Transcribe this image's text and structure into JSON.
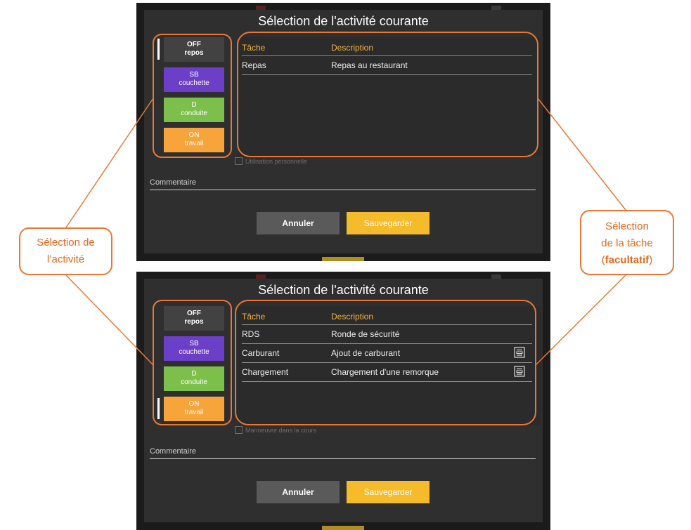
{
  "top_screen": {
    "title": "Sélection de l'activité courante",
    "statuses": [
      {
        "code": "OFF",
        "label": "repos"
      },
      {
        "code": "SB",
        "label": "couchette"
      },
      {
        "code": "D",
        "label": "conduite"
      },
      {
        "code": "ON",
        "label": "travail"
      }
    ],
    "selected_status": "OFF",
    "task_table": {
      "headers": [
        "Tâche",
        "Description"
      ],
      "rows": [
        {
          "task": "Repas",
          "description": "Repas au restaurant"
        }
      ]
    },
    "checkbox_label": "Utilisation personnelle",
    "comment_label": "Commentaire",
    "cancel_label": "Annuler",
    "save_label": "Sauvegarder"
  },
  "bottom_screen": {
    "title": "Sélection de l'activité courante",
    "statuses": [
      {
        "code": "OFF",
        "label": "repos"
      },
      {
        "code": "SB",
        "label": "couchette"
      },
      {
        "code": "D",
        "label": "conduite"
      },
      {
        "code": "ON",
        "label": "travail"
      }
    ],
    "selected_status": "ON",
    "task_table": {
      "headers": [
        "Tâche",
        "Description"
      ],
      "rows": [
        {
          "task": "RDS",
          "description": "Ronde de sécurité",
          "icon": ""
        },
        {
          "task": "Carburant",
          "description": "Ajout de carburant",
          "icon": "form-icon"
        },
        {
          "task": "Chargement",
          "description": "Chargement d'une remorque",
          "icon": "form-icon"
        }
      ]
    },
    "checkbox_label": "Manoeuvre dans la cours",
    "comment_label": "Commentaire",
    "cancel_label": "Annuler",
    "save_label": "Sauvegarder"
  },
  "callouts": {
    "left": {
      "line1": "Sélection de",
      "line2": "l’activité"
    },
    "right": {
      "line1": "Sélection",
      "line2": "de la tâche",
      "line3_open": "(",
      "line3_bold": "facultatif",
      "line3_close": ")"
    }
  },
  "colors": {
    "accent_orange": "#e97836",
    "header_gold": "#f4b43a",
    "status_off": "#424242",
    "status_sb": "#6b3fc8",
    "status_d": "#7cc04b",
    "status_on": "#f7a43b",
    "save_button": "#f5bb2b",
    "cancel_button": "#5a5a5a"
  }
}
